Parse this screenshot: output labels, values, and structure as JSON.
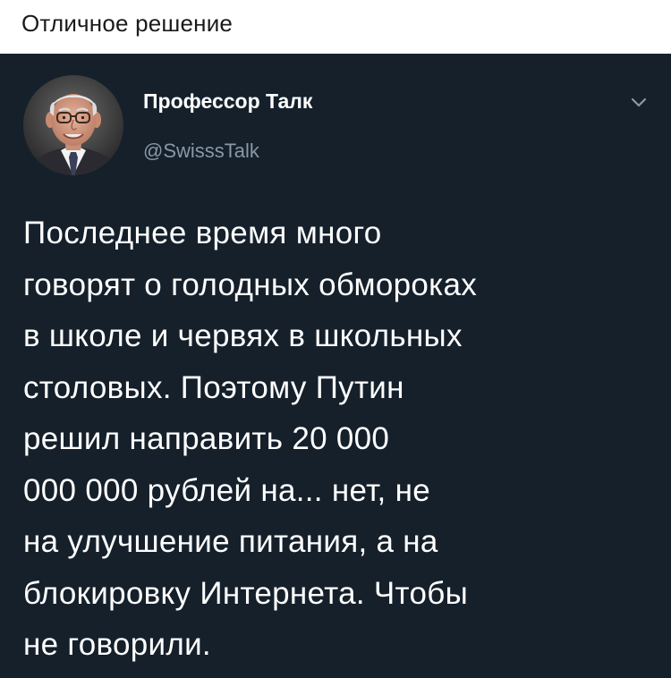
{
  "caption": "Отличное решение",
  "tweet": {
    "author": {
      "name": "Профессор Талк",
      "handle": "@SwisssTalk"
    },
    "menu_icon": "chevron-down-icon",
    "lines": [
      "Последнее время много",
      "говорят о голодных обмороках",
      "в школе и червях в школьных",
      "столовых. Поэтому Путин",
      "решил направить 20 000",
      "000 000 рублей на... нет, не",
      "на улучшение питания, а на",
      "блокировку Интернета. Чтобы",
      "не говорили."
    ]
  },
  "colors": {
    "card_background": "#15202b",
    "handle": "#8899a6",
    "text": "#ffffff"
  }
}
